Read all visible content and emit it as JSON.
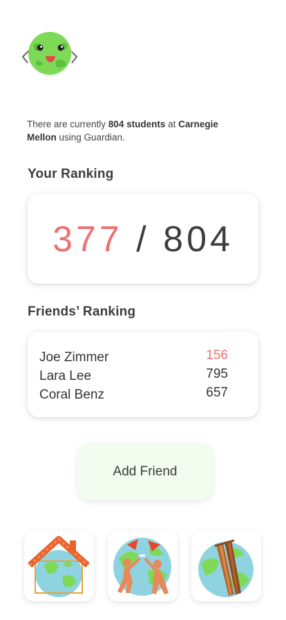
{
  "intro": {
    "prefix": "There are currently ",
    "student_count": "804 students",
    "middle": " at ",
    "school": "Carnegie Mellon",
    "suffix": " using Guardian."
  },
  "your_ranking": {
    "title": "Your Ranking",
    "rank": "377",
    "separator": " / ",
    "total": "804"
  },
  "friends_ranking": {
    "title": "Friends’ Ranking",
    "friends": [
      {
        "name": "Joe Zimmer",
        "score": "156"
      },
      {
        "name": "Lara Lee",
        "score": "795"
      },
      {
        "name": "Coral Benz",
        "score": "657"
      }
    ]
  },
  "add_friend": {
    "label": "Add Friend"
  },
  "badges": [
    "house-earth-icon",
    "people-earth-icon",
    "chopsticks-earth-icon"
  ],
  "colors": {
    "accent": "#ee7171",
    "button_bg": "#f2fdf0",
    "earth_green": "#7ed957",
    "ocean": "#8fd3e0"
  }
}
